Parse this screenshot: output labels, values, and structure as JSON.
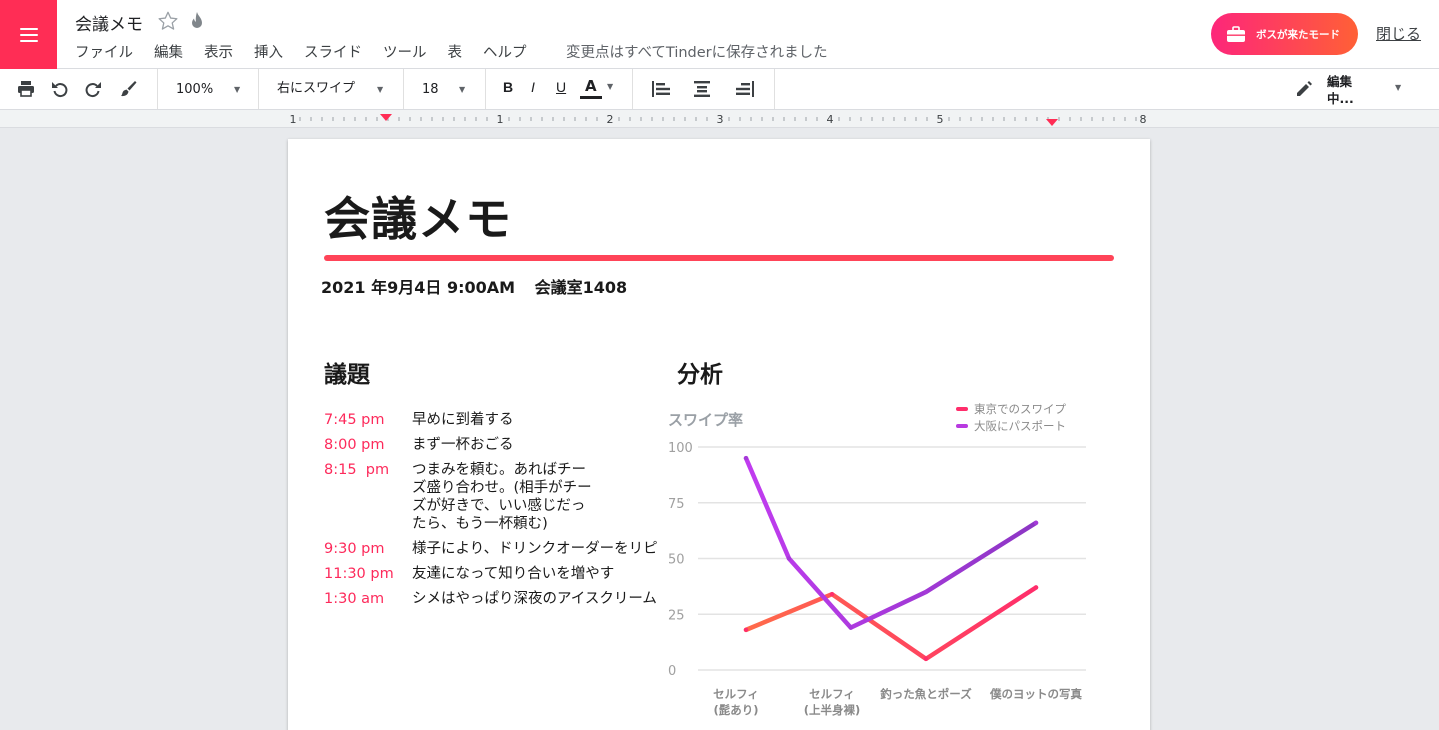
{
  "header": {
    "doc_title": "会議メモ",
    "menu": [
      "ファイル",
      "編集",
      "表示",
      "挿入",
      "スライド",
      "ツール",
      "表",
      "ヘルプ"
    ],
    "save_status": "変更点はすべてTinderに保存されました",
    "boss_button": "ボスが来たモード",
    "close": "閉じる",
    "accent_color": "#ff2d55"
  },
  "toolbar": {
    "zoom": "100%",
    "font": "右にスワイプ",
    "font_size": "18",
    "bold": "B",
    "italic": "I",
    "underline": "U",
    "text_color": "A",
    "mode": "編集中..."
  },
  "ruler": {
    "numbers": [
      "1",
      "1",
      "2",
      "3",
      "4",
      "5",
      "8"
    ]
  },
  "doc": {
    "title": "会議メモ",
    "date": "2021 年9月4日 9:00AM",
    "room": "会議室1408",
    "agenda_heading": "議題",
    "analysis_heading": "分析",
    "agenda": [
      {
        "time": "7:45 pm",
        "item": "早めに到着する"
      },
      {
        "time": "8:00 pm",
        "item": "まず一杯おごる"
      },
      {
        "time": "8:15  pm",
        "item": "つまみを頼む。あればチーズ盛り合わせ。(相手がチーズが好きで、いい感じだったら、もう一杯頼む)"
      },
      {
        "time": "9:30 pm",
        "item": "様子により、ドリンクオーダーをリピ"
      },
      {
        "time": "11:30 pm",
        "item": "友達になって知り合いを増やす"
      },
      {
        "time": "1:30 am",
        "item": "シメはやっぱり深夜のアイスクリーム"
      }
    ]
  },
  "chart_data": {
    "type": "line",
    "title": "スワイプ率",
    "categories": [
      "セルフィ\n(髭あり)",
      "セルフィ\n(上半身裸)",
      "釣った魚とポーズ",
      "僕のヨットの写真"
    ],
    "series": [
      {
        "name": "東京でのスワイプ",
        "x": [
          0,
          1,
          2,
          3
        ],
        "values": [
          18,
          34,
          5,
          37
        ],
        "color": "#ff2d6b"
      },
      {
        "name": "大阪にパスポート",
        "x": [
          0,
          0.5,
          1.2,
          2,
          3
        ],
        "values": [
          95,
          50,
          19,
          35,
          66
        ],
        "color": "#b83ae0"
      }
    ],
    "ylim": [
      0,
      100
    ],
    "yticks": [
      0,
      25,
      50,
      75,
      100
    ],
    "grid": true,
    "legend": "top-right"
  }
}
